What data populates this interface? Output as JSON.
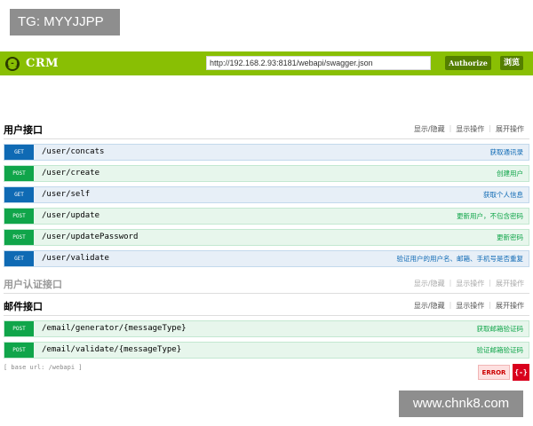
{
  "watermark_top": "TG: MYYJJPP",
  "watermark_bottom": "www.chnk8.com",
  "header": {
    "logo_icon": "{-}",
    "app_name": "CRM",
    "url_value": "http://192.168.2.93:8181/webapi/swagger.json",
    "authorize_label": "Authorize",
    "explore_label": "浏览",
    "brand_color": "#89bf04"
  },
  "sections": [
    {
      "title": "用户接口",
      "links": [
        "显示/隐藏",
        "显示操作",
        "展开操作"
      ],
      "ops": [
        {
          "method": "GET",
          "path": "/user/concats",
          "summary": "获取通讯录"
        },
        {
          "method": "POST",
          "path": "/user/create",
          "summary": "创建用户"
        },
        {
          "method": "GET",
          "path": "/user/self",
          "summary": "获取个人信息"
        },
        {
          "method": "POST",
          "path": "/user/update",
          "summary": "更新用户，不包含密码"
        },
        {
          "method": "POST",
          "path": "/user/updatePassword",
          "summary": "更新密码"
        },
        {
          "method": "GET",
          "path": "/user/validate",
          "summary": "验证用户的用户名、邮箱、手机号是否重复"
        }
      ]
    },
    {
      "title": "用户认证接口",
      "links": [
        "显示/隐藏",
        "显示操作",
        "展开操作"
      ],
      "ops": []
    },
    {
      "title": "邮件接口",
      "links": [
        "显示/隐藏",
        "显示操作",
        "展开操作"
      ],
      "ops": [
        {
          "method": "POST",
          "path": "/email/generator/{messageType}",
          "summary": "获取邮箱验证码"
        },
        {
          "method": "POST",
          "path": "/email/validate/{messageType}",
          "summary": "验证邮箱验证码"
        }
      ]
    }
  ],
  "footer": {
    "base_url": "[ base url: /webapi ]",
    "error_label": "ERROR",
    "error_icon": "{-}"
  }
}
